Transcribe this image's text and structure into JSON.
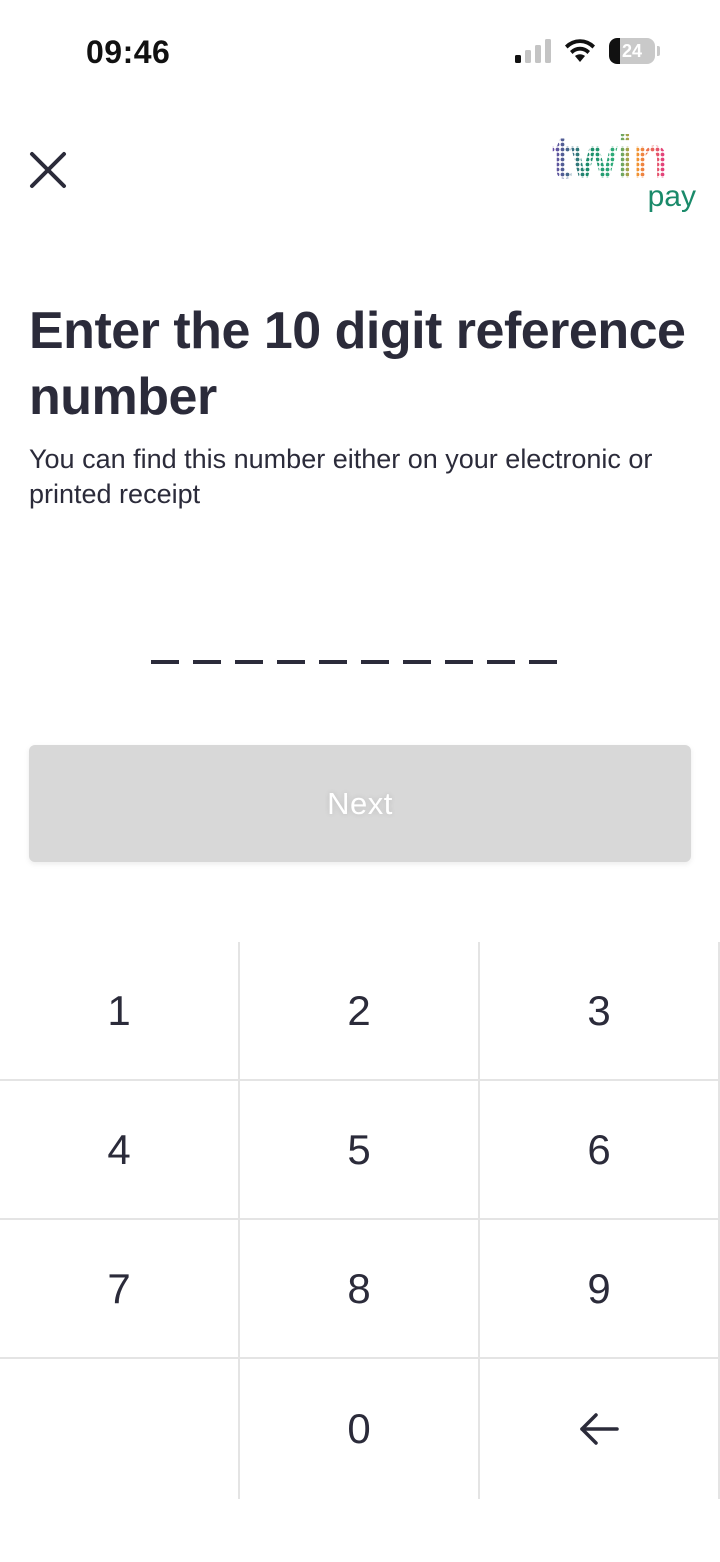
{
  "status_bar": {
    "time": "09:46",
    "battery_level": "24",
    "battery_fraction": 0.24,
    "icons": [
      "cellular-signal-icon",
      "wifi-icon",
      "battery-icon"
    ]
  },
  "header": {
    "close_icon": "close-icon",
    "logo": {
      "word": "twin",
      "sub": "pay"
    }
  },
  "main": {
    "title": "Enter the 10 digit reference number",
    "subtitle": "You can find this number either on your electronic or printed receipt",
    "reference_slots": [
      "",
      "",
      "",
      "",
      "",
      "",
      "",
      "",
      "",
      ""
    ],
    "next_label": "Next",
    "next_enabled": false
  },
  "keypad": {
    "keys": [
      "1",
      "2",
      "3",
      "4",
      "5",
      "6",
      "7",
      "8",
      "9",
      "",
      "0",
      "backspace"
    ],
    "backspace_icon": "arrow-left-icon"
  },
  "colors": {
    "text": "#2b2b3a",
    "button_disabled": "#d8d8d8",
    "divider": "#e4e4e4",
    "logo_green": "#1a8a6a",
    "logo_purple": "#6b4aa8",
    "logo_pink": "#e0338a",
    "logo_orange": "#f39a2b"
  }
}
